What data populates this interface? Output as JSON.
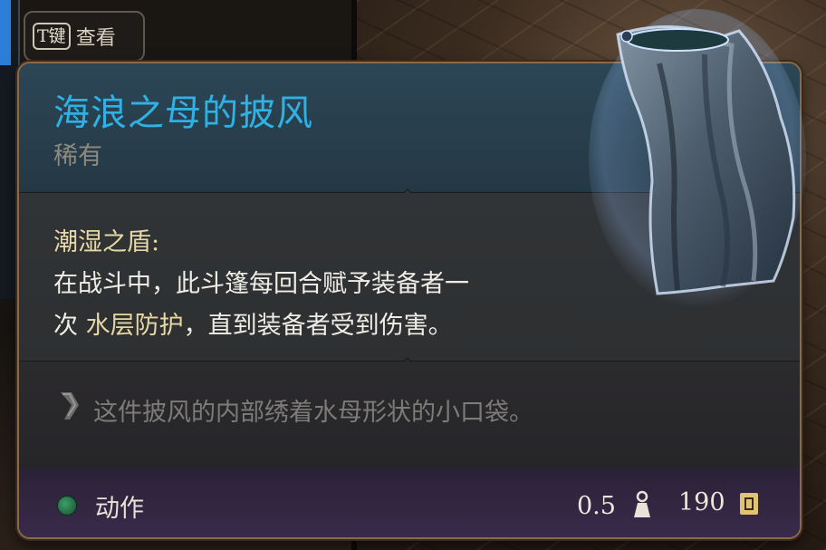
{
  "key_hint": {
    "key": "T键",
    "label": "查看"
  },
  "item": {
    "name": "海浪之母的披风",
    "rarity": "稀有",
    "ability_name": "潮湿之盾:",
    "description_line1": "在战斗中，此斗篷每回合赋予装备者一",
    "description_line2_prefix": "次 ",
    "description_keyword": "水层防护",
    "description_line2_suffix": "，直到装备者受到伤害。",
    "flavor": "这件披风的内部绣着水母形状的小口袋。"
  },
  "footer": {
    "action_label": "动作",
    "weight": "0.5",
    "price": "190"
  },
  "colors": {
    "name_color": "#2eb2e6",
    "ability_color": "#e6d8a6",
    "border": "#8a6a4a",
    "status_dot": "#3ca06a"
  },
  "icons": [
    "cloak-item-icon",
    "feather-quill-icon",
    "weight-icon",
    "gold-coin-icon",
    "status-dot-icon"
  ]
}
